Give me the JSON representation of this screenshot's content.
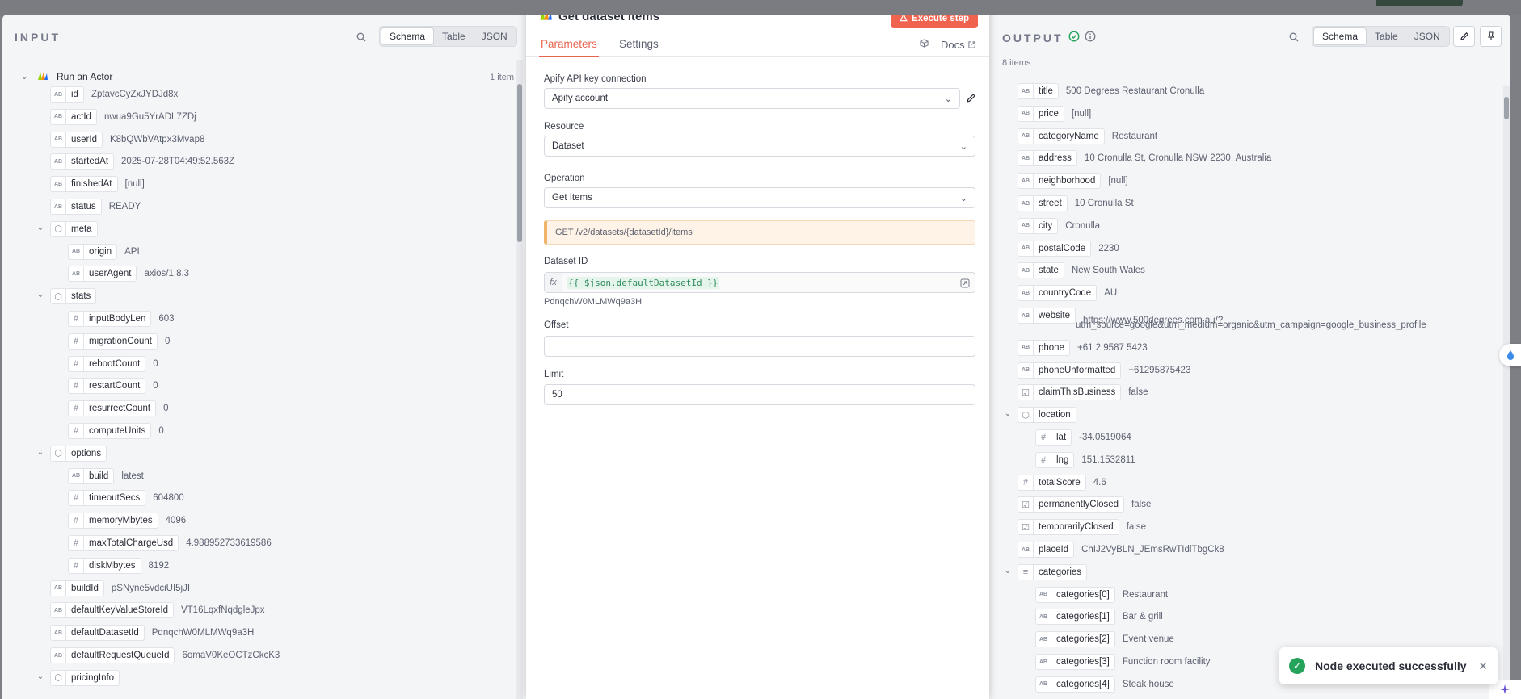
{
  "input": {
    "title": "INPUT",
    "views": [
      "Schema",
      "Table",
      "JSON"
    ],
    "active_view": "Schema",
    "root_label": "Run an Actor",
    "item_count": "1 item",
    "fields": [
      {
        "key": "id",
        "value": "ZptavcCyZxJYDJd8x",
        "type": "string",
        "depth": 0
      },
      {
        "key": "actId",
        "value": "nwua9Gu5YrADL7ZDj",
        "type": "string",
        "depth": 0
      },
      {
        "key": "userId",
        "value": "K8bQWbVAtpx3Mvap8",
        "type": "string",
        "depth": 0
      },
      {
        "key": "startedAt",
        "value": "2025-07-28T04:49:52.563Z",
        "type": "string",
        "depth": 0
      },
      {
        "key": "finishedAt",
        "value": "[null]",
        "type": "string",
        "depth": 0
      },
      {
        "key": "status",
        "value": "READY",
        "type": "string",
        "depth": 0
      },
      {
        "key": "meta",
        "value": "",
        "type": "object",
        "depth": 0
      },
      {
        "key": "origin",
        "value": "API",
        "type": "string",
        "depth": 1
      },
      {
        "key": "userAgent",
        "value": "axios/1.8.3",
        "type": "string",
        "depth": 1
      },
      {
        "key": "stats",
        "value": "",
        "type": "object",
        "depth": 0
      },
      {
        "key": "inputBodyLen",
        "value": "603",
        "type": "number",
        "depth": 1
      },
      {
        "key": "migrationCount",
        "value": "0",
        "type": "number",
        "depth": 1
      },
      {
        "key": "rebootCount",
        "value": "0",
        "type": "number",
        "depth": 1
      },
      {
        "key": "restartCount",
        "value": "0",
        "type": "number",
        "depth": 1
      },
      {
        "key": "resurrectCount",
        "value": "0",
        "type": "number",
        "depth": 1
      },
      {
        "key": "computeUnits",
        "value": "0",
        "type": "number",
        "depth": 1
      },
      {
        "key": "options",
        "value": "",
        "type": "object",
        "depth": 0
      },
      {
        "key": "build",
        "value": "latest",
        "type": "string",
        "depth": 1
      },
      {
        "key": "timeoutSecs",
        "value": "604800",
        "type": "number",
        "depth": 1
      },
      {
        "key": "memoryMbytes",
        "value": "4096",
        "type": "number",
        "depth": 1
      },
      {
        "key": "maxTotalChargeUsd",
        "value": "4.988952733619586",
        "type": "number",
        "depth": 1
      },
      {
        "key": "diskMbytes",
        "value": "8192",
        "type": "number",
        "depth": 1
      },
      {
        "key": "buildId",
        "value": "pSNyne5vdciUI5jJI",
        "type": "string",
        "depth": 0
      },
      {
        "key": "defaultKeyValueStoreId",
        "value": "VT16LqxfNqdgleJpx",
        "type": "string",
        "depth": 0
      },
      {
        "key": "defaultDatasetId",
        "value": "PdnqchW0MLMWq9a3H",
        "type": "string",
        "depth": 0
      },
      {
        "key": "defaultRequestQueueId",
        "value": "6omaV0KeOCTzCkcK3",
        "type": "string",
        "depth": 0
      },
      {
        "key": "pricingInfo",
        "value": "",
        "type": "object",
        "depth": 0
      }
    ]
  },
  "node": {
    "title": "Get dataset items",
    "execute_label": "Execute step",
    "tabs": [
      "Parameters",
      "Settings"
    ],
    "active_tab": "Parameters",
    "docs_label": "Docs",
    "credential_label": "Apify API key connection",
    "credential_value": "Apify account",
    "resource_label": "Resource",
    "resource_value": "Dataset",
    "operation_label": "Operation",
    "operation_value": "Get Items",
    "endpoint_hint": "GET /v2/datasets/{datasetId}/items",
    "dataset_label": "Dataset ID",
    "dataset_expression": "{{ $json.defaultDatasetId }}",
    "dataset_resolved": "PdnqchW0MLMWq9a3H",
    "offset_label": "Offset",
    "offset_value": "",
    "limit_label": "Limit",
    "limit_value": "50"
  },
  "output": {
    "title": "OUTPUT",
    "views": [
      "Schema",
      "Table",
      "JSON"
    ],
    "active_view": "Schema",
    "item_count": "8 items",
    "fields": [
      {
        "key": "title",
        "value": "500 Degrees Restaurant Cronulla",
        "type": "string",
        "depth": 0
      },
      {
        "key": "price",
        "value": "[null]",
        "type": "string",
        "depth": 0
      },
      {
        "key": "categoryName",
        "value": "Restaurant",
        "type": "string",
        "depth": 0
      },
      {
        "key": "address",
        "value": "10 Cronulla St, Cronulla NSW 2230, Australia",
        "type": "string",
        "depth": 0
      },
      {
        "key": "neighborhood",
        "value": "[null]",
        "type": "string",
        "depth": 0
      },
      {
        "key": "street",
        "value": "10 Cronulla St",
        "type": "string",
        "depth": 0
      },
      {
        "key": "city",
        "value": "Cronulla",
        "type": "string",
        "depth": 0
      },
      {
        "key": "postalCode",
        "value": "2230",
        "type": "string",
        "depth": 0
      },
      {
        "key": "state",
        "value": "New South Wales",
        "type": "string",
        "depth": 0
      },
      {
        "key": "countryCode",
        "value": "AU",
        "type": "string",
        "depth": 0
      },
      {
        "key": "website",
        "value": "https://www.500degrees.com.au/?",
        "value2": "utm_source=google&utm_medium=organic&utm_campaign=google_business_profile",
        "type": "string",
        "depth": 0
      },
      {
        "key": "phone",
        "value": "+61 2 9587 5423",
        "type": "string",
        "depth": 0
      },
      {
        "key": "phoneUnformatted",
        "value": "+61295875423",
        "type": "string",
        "depth": 0
      },
      {
        "key": "claimThisBusiness",
        "value": "false",
        "type": "boolean",
        "depth": 0
      },
      {
        "key": "location",
        "value": "",
        "type": "object",
        "depth": 0
      },
      {
        "key": "lat",
        "value": "-34.0519064",
        "type": "number",
        "depth": 1
      },
      {
        "key": "lng",
        "value": "151.1532811",
        "type": "number",
        "depth": 1
      },
      {
        "key": "totalScore",
        "value": "4.6",
        "type": "number",
        "depth": 0
      },
      {
        "key": "permanentlyClosed",
        "value": "false",
        "type": "boolean",
        "depth": 0
      },
      {
        "key": "temporarilyClosed",
        "value": "false",
        "type": "boolean",
        "depth": 0
      },
      {
        "key": "placeId",
        "value": "ChIJ2VyBLN_JEmsRwTIdlTbgCk8",
        "type": "string",
        "depth": 0
      },
      {
        "key": "categories",
        "value": "",
        "type": "array",
        "depth": 0
      },
      {
        "key": "categories[0]",
        "value": "Restaurant",
        "type": "string",
        "depth": 1
      },
      {
        "key": "categories[1]",
        "value": "Bar & grill",
        "type": "string",
        "depth": 1
      },
      {
        "key": "categories[2]",
        "value": "Event venue",
        "type": "string",
        "depth": 1
      },
      {
        "key": "categories[3]",
        "value": "Function room facility",
        "type": "string",
        "depth": 1
      },
      {
        "key": "categories[4]",
        "value": "Steak house",
        "type": "string",
        "depth": 1
      }
    ]
  },
  "toast": {
    "message": "Node executed successfully"
  },
  "colors": {
    "accent": "#f0644f",
    "success": "#26a35a"
  }
}
